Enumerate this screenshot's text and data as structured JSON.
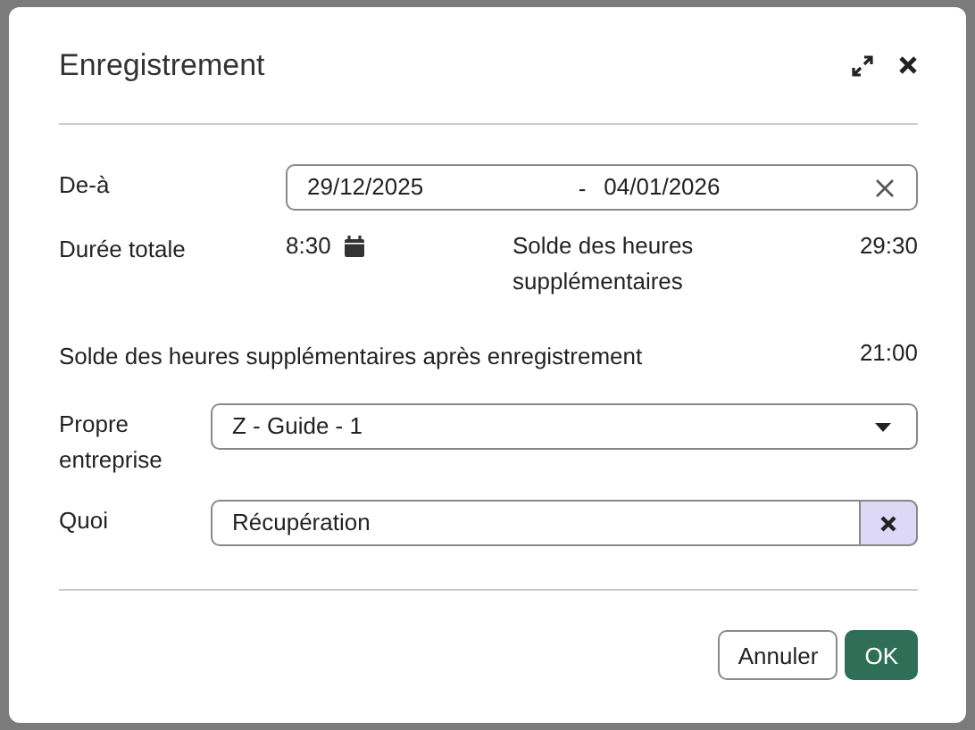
{
  "dialog": {
    "title": "Enregistrement",
    "date_range": {
      "label": "De-à",
      "from": "29/12/2025",
      "separator": "-",
      "to": "04/01/2026"
    },
    "total": {
      "label": "Durée totale",
      "value": "8:30"
    },
    "balance": {
      "label": "Solde des heures supplémentaires",
      "value": "29:30"
    },
    "balance_after": {
      "label": "Solde des heures supplémentaires après enregistrement",
      "value": "21:00"
    },
    "company": {
      "label": "Propre entreprise",
      "value": "Z - Guide - 1"
    },
    "what": {
      "label": "Quoi",
      "value": "Récupération"
    },
    "buttons": [
      {
        "label": "Annuler",
        "kind": "secondary"
      },
      {
        "label": "OK",
        "kind": "primary"
      }
    ]
  }
}
